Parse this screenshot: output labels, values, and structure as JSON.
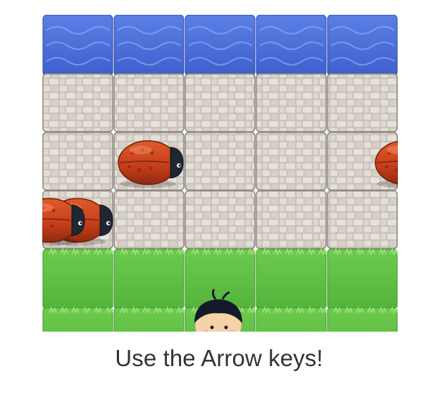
{
  "game": {
    "instruction": "Use the Arrow keys!",
    "board": {
      "columns": 5,
      "row_types": [
        "water",
        "stone",
        "stone",
        "stone",
        "grass",
        "grass"
      ]
    },
    "sprites": {
      "player": "char-boy",
      "enemy": "enemy-bug"
    },
    "colors": {
      "water": "#4d6fd8",
      "stone": "#d9d4cc",
      "grass": "#5fbf45",
      "bug": "#c8401e",
      "text": "#333333"
    }
  }
}
